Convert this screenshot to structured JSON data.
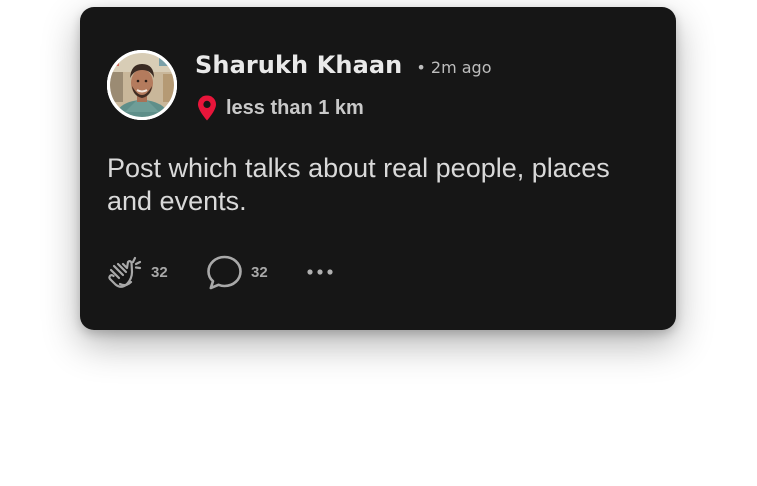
{
  "post": {
    "author_name": "Sharukh Khaan",
    "time_ago": "• 2m ago",
    "location": "less than 1 km",
    "body": "Post which talks about real people, places and events.",
    "claps": "32",
    "comments": "32"
  },
  "icons": {
    "avatar": "profile-photo",
    "location": "map-pin-icon",
    "clap": "clapping-hands-icon",
    "comment": "speech-bubble-icon",
    "more": "ellipsis-icon"
  },
  "colors": {
    "card_background": "#161616",
    "accent_pin": "#e8153a",
    "primary_text": "#e9e9e9",
    "secondary_text": "#bdbdbd"
  }
}
